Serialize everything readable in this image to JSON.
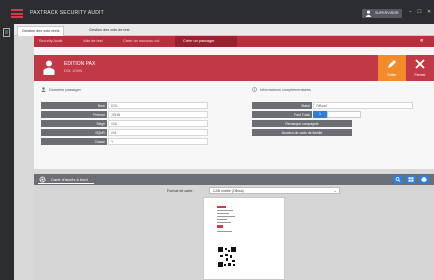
{
  "app": {
    "title": "PAXTRACK SECURITY AUDIT",
    "user": "SUPERVISOR",
    "window_controls": "– ☐ ✕"
  },
  "tabs": [
    {
      "label": "Gestion des vols réels",
      "active": true
    },
    {
      "label": "Gestion des vols de test",
      "active": false
    }
  ],
  "breadcrumb": [
    {
      "label": "Security Audit",
      "active": false
    },
    {
      "label": "Vols de test",
      "active": false
    },
    {
      "label": "Créer un nouveau vol",
      "active": false
    },
    {
      "label": "Créer un passager",
      "active": true
    }
  ],
  "header": {
    "name": "EDITION PAX",
    "subtitle": "DOL JOHN",
    "edit_label": "Editer",
    "close_label": "Fermer"
  },
  "passenger": {
    "section_title": "Données passager",
    "fields": [
      {
        "label": "Nom",
        "value": "DOL"
      },
      {
        "label": "Prénom",
        "value": "JOHN"
      },
      {
        "label": "Siège",
        "value": "10A"
      },
      {
        "label": "SQNR",
        "value": "001"
      },
      {
        "label": "Classe",
        "value": "Y"
      }
    ]
  },
  "extra": {
    "section_title": "Informations complémentaires",
    "statut_label": "Statut",
    "statut_value": "Offload",
    "fast_track_label": "Fast Track",
    "fast_track_value": "1",
    "remarque_label": "Remarque compagnie",
    "fidelite_label": "Numéro de carte de fidélité"
  },
  "boarding": {
    "title": "Carte d'accès à bord",
    "format_label": "Format de carte :",
    "format_value": "CAB mobile (Ofissa)",
    "format_icon": "chevron-down-icon"
  },
  "colors": {
    "accent": "#c13947",
    "edit": "#f28b2a",
    "primary_blue": "#2f7fd8",
    "dark": "#2b2d30"
  }
}
